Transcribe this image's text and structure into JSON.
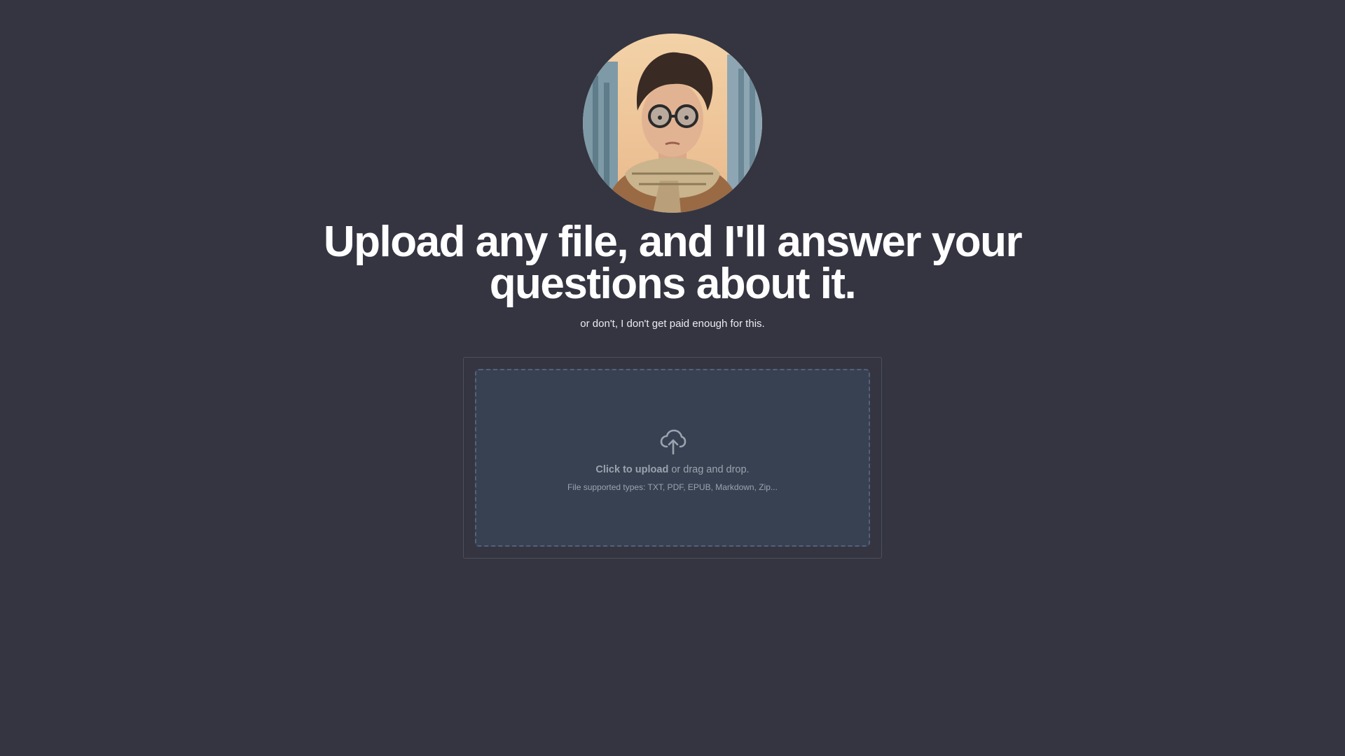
{
  "hero": {
    "avatar_icon": "avatar-illustration",
    "headline_line1": "Upload any file, and I'll answer your",
    "headline_line2": "questions about it.",
    "subtitle": "or don't, I don't get paid enough for this."
  },
  "upload": {
    "icon": "cloud-upload-icon",
    "click_label": "Click to upload",
    "drag_label": " or drag and drop.",
    "types_text": "File supported types: TXT, PDF, EPUB, Markdown, Zip..."
  },
  "colors": {
    "background": "#343541",
    "dropzone": "#374151",
    "muted_text": "#9ca3af"
  }
}
